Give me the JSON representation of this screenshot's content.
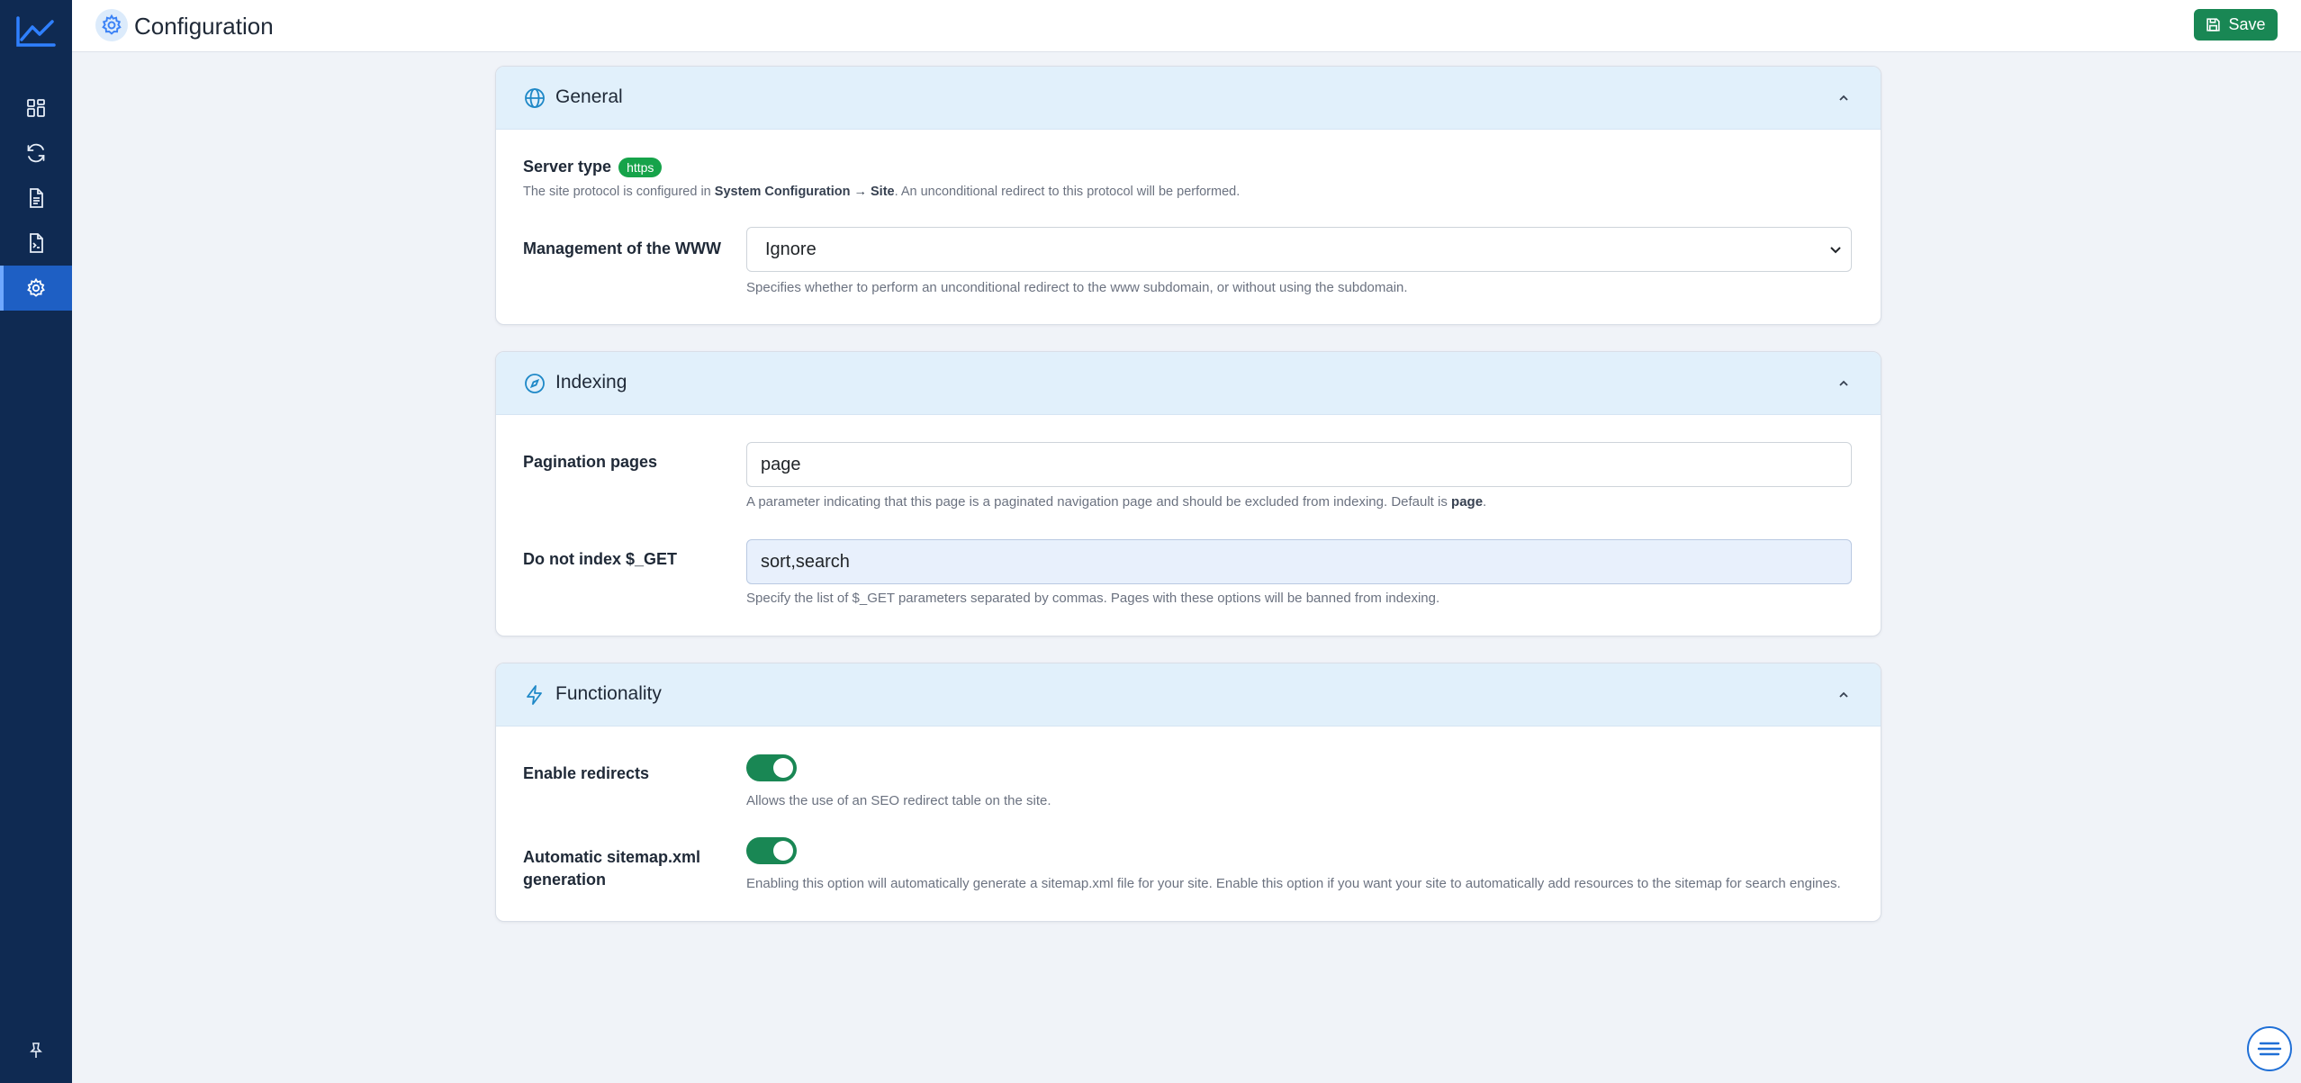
{
  "header": {
    "title": "Configuration",
    "save_label": "Save"
  },
  "sidebar": {
    "items": [
      {
        "icon": "dashboard-grid-icon"
      },
      {
        "icon": "refresh-icon"
      },
      {
        "icon": "document-icon"
      },
      {
        "icon": "code-file-icon"
      },
      {
        "icon": "gear-icon",
        "active": true
      }
    ]
  },
  "sections": {
    "general": {
      "title": "General",
      "server_type_label": "Server type",
      "server_type_badge": "https",
      "server_help_prefix": "The site protocol is configured in ",
      "server_help_bold": "System Configuration → Site",
      "server_help_suffix": ". An unconditional redirect to this protocol will be performed.",
      "www_label": "Management of the WWW",
      "www_value": "Ignore",
      "www_help": "Specifies whether to perform an unconditional redirect to the www subdomain, or without using the subdomain."
    },
    "indexing": {
      "title": "Indexing",
      "pagination_label": "Pagination pages",
      "pagination_value": "page",
      "pagination_help_prefix": "A parameter indicating that this page is a paginated navigation page and should be excluded from indexing. Default is ",
      "pagination_help_bold": "page",
      "pagination_help_suffix": ".",
      "noindex_label": "Do not index $_GET",
      "noindex_value": "sort,search",
      "noindex_help": "Specify the list of $_GET parameters separated by commas. Pages with these options will be banned from indexing."
    },
    "functionality": {
      "title": "Functionality",
      "redirects_label": "Enable redirects",
      "redirects_enabled": true,
      "redirects_help": "Allows the use of an SEO redirect table on the site.",
      "sitemap_label_line1": "Automatic sitemap.xml",
      "sitemap_label_line2": "generation",
      "sitemap_enabled": true,
      "sitemap_help": "Enabling this option will automatically generate a sitemap.xml file for your site. Enable this option if you want your site to automatically add resources to the sitemap for search engines."
    }
  },
  "colors": {
    "sidebar": "#0f2a52",
    "accent": "#1e5fc4",
    "success": "#198754",
    "card_header": "#e1f0fb"
  }
}
